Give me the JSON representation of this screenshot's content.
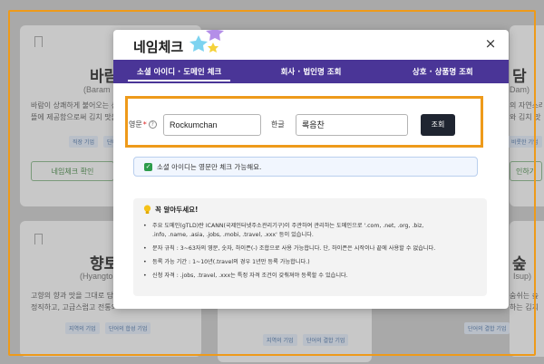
{
  "background": {
    "cards": [
      {
        "title": "바람",
        "subtitle": "(Baram",
        "desc1": "바람이 상쾌하게 불어오는 산",
        "desc2": "뜰에 제공함으로써 김치 맛을",
        "tags": [
          "직장 기업",
          "단어의"
        ],
        "button": "네임체크 확인"
      },
      {
        "title": "향토",
        "subtitle": "(Hyangto",
        "desc1": "고향의 향과 맛을 그대로 담",
        "desc2": "정직하고, 고급스럽고 전통의",
        "tags": [
          "지역의 기업",
          "단어의 합성 기업"
        ],
        "button": ""
      }
    ],
    "right_cards": [
      {
        "title": "담",
        "subtitle": "Dam)",
        "desc1": "의 자연스러",
        "desc2": "와 김치 맛",
        "tags": [
          "비롯한 기업"
        ],
        "button": "인하기"
      },
      {
        "title": "숲",
        "subtitle": "Isup)",
        "desc1": "숨쉬는 숲",
        "desc2": "하는 김치",
        "tags": [
          "단어의 결합 기업"
        ],
        "button": ""
      }
    ],
    "center_tags": [
      "지역의 기업",
      "단어의 결합 기업"
    ]
  },
  "modal": {
    "title": "네임체크",
    "close_label": "×",
    "tabs": [
      {
        "label": "소셜 아이디 · 도메인 체크",
        "active": true
      },
      {
        "label": "회사 · 법인명 조회",
        "active": false
      },
      {
        "label": "상호 · 상품명 조회",
        "active": false
      }
    ],
    "search": {
      "english_label": "영문",
      "required_mark": "*",
      "help_glyph": "?",
      "english_value": "Rockumchan",
      "korean_label": "한글",
      "korean_value": "록음찬",
      "button_label": "조회"
    },
    "notice": "소셜 아이디는 영문만 체크 가능해요.",
    "info": {
      "title": "꼭 알아두세요!",
      "items": [
        "주요 도메인(gTLD)란 ICANN(국제인터넷주소관리기구)이 주관하여 관리하는 도메인으로 '.com, .net, .org, .biz,",
        ".info, .name, .asia, .jobs, .mobi, .travel, .xxx' 등이 있습니다.",
        "문자 규칙 : 3~63자의 영문, 숫자, 하이픈(-) 조합으로 사용 가능합니다. 단, 하이픈은 시작이나 끝에 사용할 수 없습니다.",
        "등록 가능 기간 : 1~10년(.travel의 경우 1년만 등록 가능합니다.)",
        "신청 자격 : .jobs, .travel, .xxx는 특정 자격 조건이 갖춰져야 등록할 수 있습니다."
      ]
    }
  },
  "colors": {
    "tab_bar": "#4a3597",
    "highlight_outline": "#ee9a1a",
    "search_button": "#1f2531",
    "check": "#2d9c4b"
  }
}
